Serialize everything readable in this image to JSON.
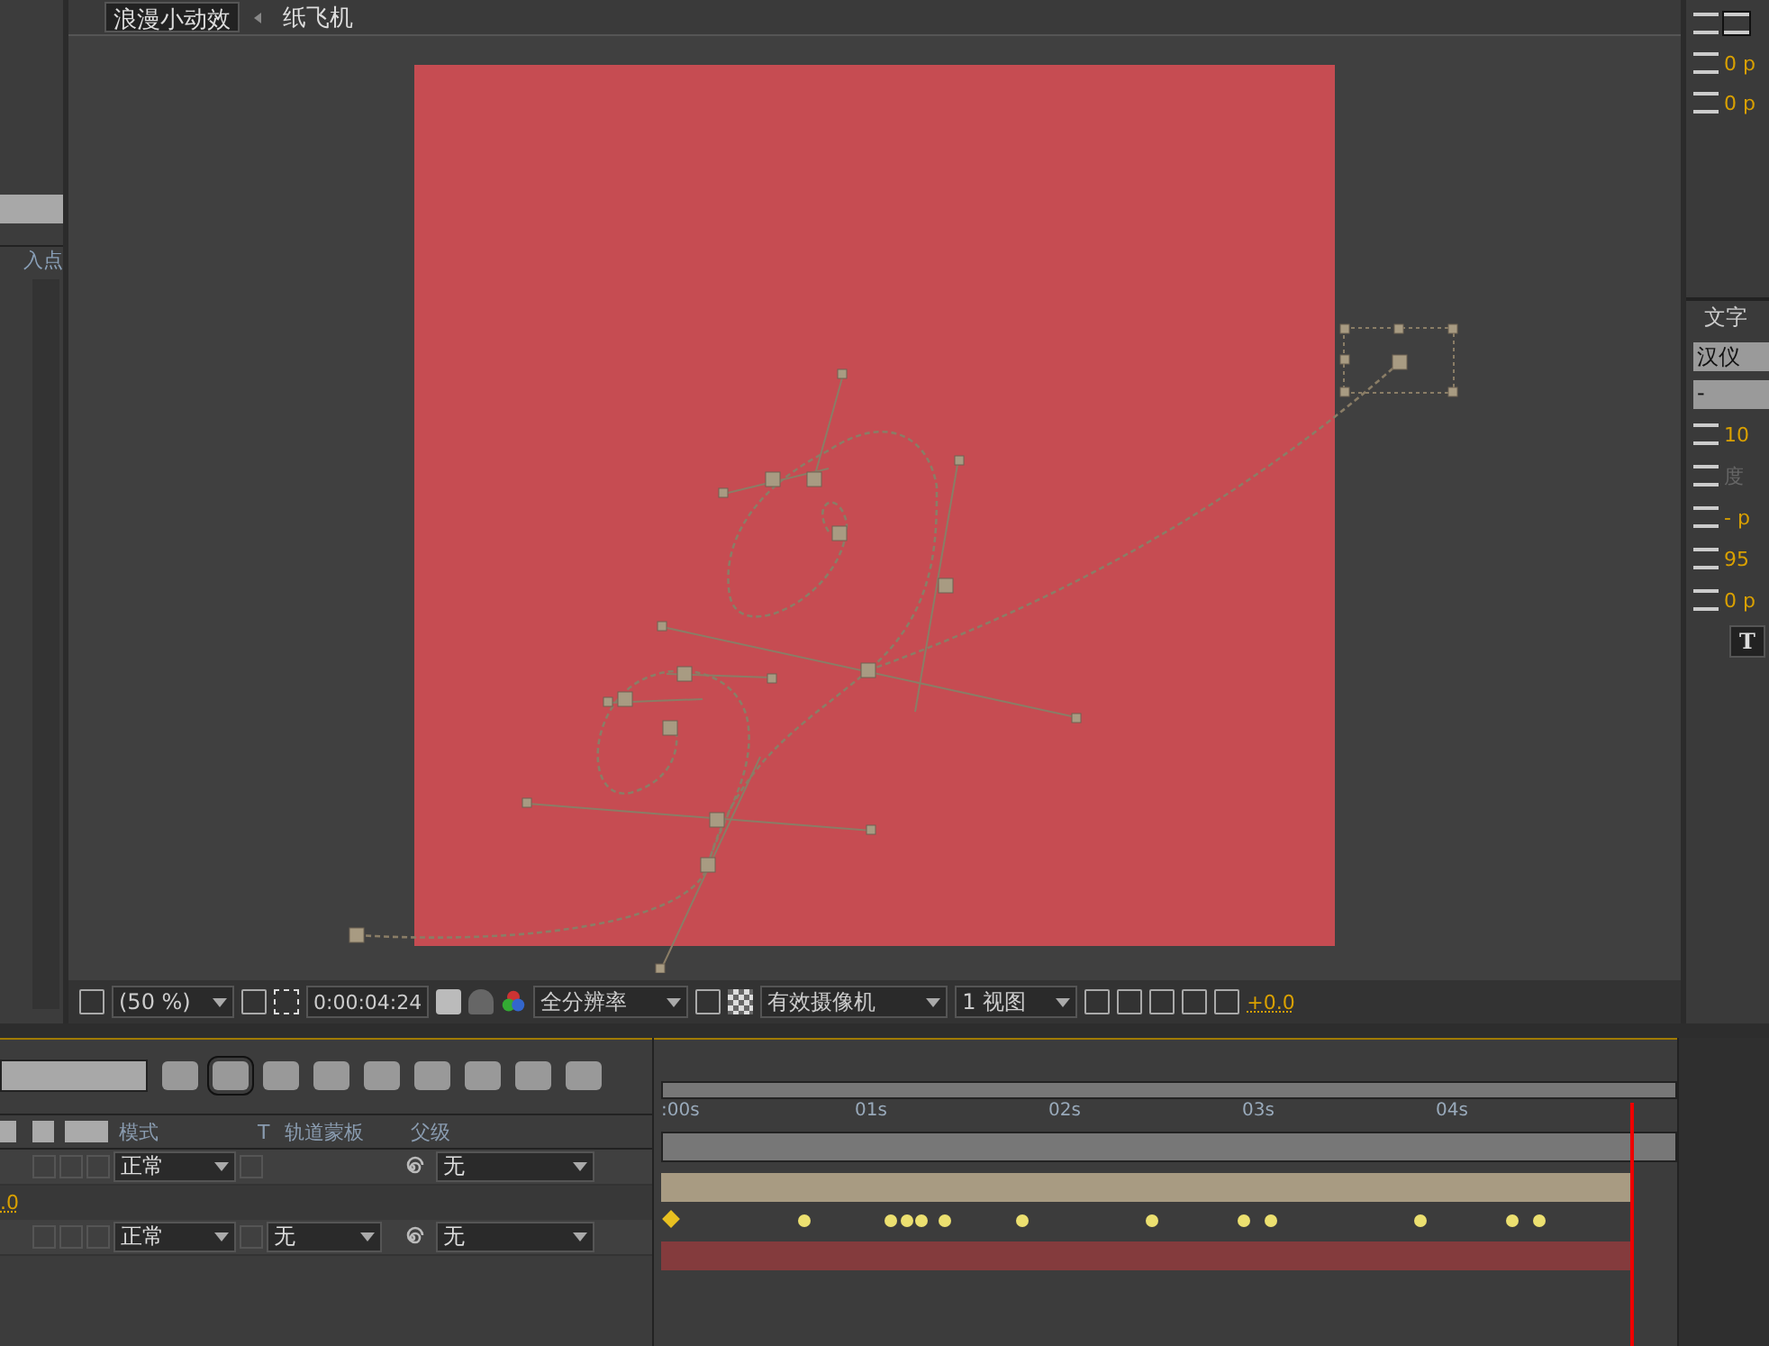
{
  "composition_tabs": [
    {
      "label": "浪漫小动效",
      "selected": true
    },
    {
      "label": "纸飞机",
      "selected": false
    }
  ],
  "left_panel": {
    "column_header": "入点"
  },
  "viewer_toolbar": {
    "zoom": "(50 %)",
    "timecode": "0:00:04:24",
    "resolution": "全分辨率",
    "camera": "有效摄像机",
    "views": "1 视图",
    "exposure": "+0.0"
  },
  "right_panel": {
    "indent_values": [
      "0 p",
      "0 p"
    ],
    "character_tab": "文字",
    "font_family": "汉仪",
    "font_style": "-",
    "font_size": "10",
    "tracking": "度",
    "leading": "- p",
    "vertical_scale": "95",
    "baseline_shift": "0 p",
    "faux_bold": "T"
  },
  "timeline": {
    "columns": [
      "模式",
      "T",
      "轨道蒙板",
      "父级"
    ],
    "time_labels": [
      ":00s",
      "01s",
      "02s",
      "03s",
      "04s"
    ],
    "property_value": ".0",
    "layers": [
      {
        "mode": "正常",
        "parent": "无",
        "color": "#a89b82"
      },
      {
        "mode": "正常",
        "track_matte": "无",
        "parent": "无",
        "color": "#843b3d"
      }
    ]
  }
}
